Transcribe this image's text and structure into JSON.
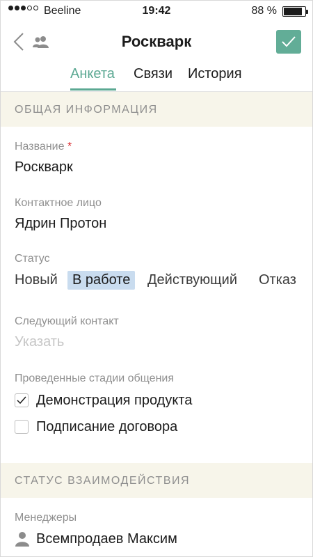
{
  "status_bar": {
    "carrier": "Beeline",
    "time": "19:42",
    "battery_text": "88 %",
    "battery_level": 0.88,
    "signal_bars_filled": 3,
    "signal_bars_total": 5
  },
  "header": {
    "title": "Роскварк",
    "back_icon": "chevron-left-icon",
    "people_icon": "people-icon",
    "save_icon": "checkmark-icon"
  },
  "tabs": [
    {
      "label": "Анкета",
      "active": true
    },
    {
      "label": "Связи",
      "active": false
    },
    {
      "label": "История",
      "active": false
    }
  ],
  "sections": {
    "general": "ОБЩАЯ ИНФОРМАЦИЯ",
    "interaction": "СТАТУС ВЗАИМОДЕЙСТВИЯ"
  },
  "fields": {
    "name": {
      "label": "Название",
      "required_mark": "*",
      "value": "Роскварк"
    },
    "contact": {
      "label": "Контактное лицо",
      "value": "Ядрин Протон"
    },
    "status": {
      "label": "Статус",
      "options": [
        "Новый",
        "В работе",
        "Действующий",
        "Отказ"
      ],
      "selected": "В работе"
    },
    "next_contact": {
      "label": "Следующий контакт",
      "placeholder": "Указать"
    },
    "stages": {
      "label": "Проведенные стадии общения",
      "items": [
        {
          "label": "Демонстрация продукта",
          "checked": true
        },
        {
          "label": "Подписание договора",
          "checked": false
        }
      ]
    },
    "managers": {
      "label": "Менеджеры",
      "items": [
        {
          "name": "Всемпродаев Максим"
        }
      ]
    }
  },
  "colors": {
    "accent": "#5ba892",
    "save_button": "#62ad97",
    "section_bg": "#f7f5ea",
    "selected_status_bg": "#c9dcef",
    "required": "#d9262a"
  }
}
